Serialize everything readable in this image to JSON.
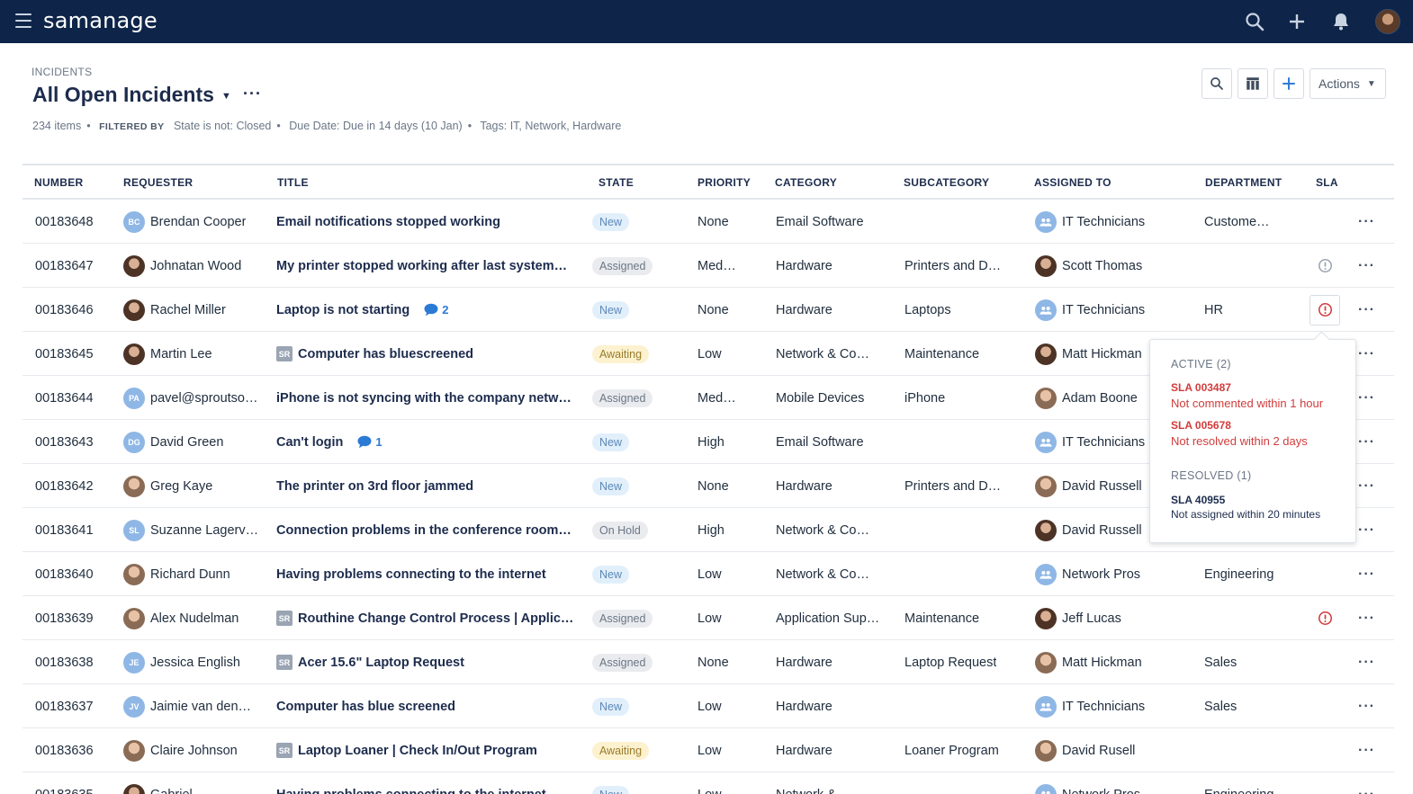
{
  "app": {
    "logo": "samanage"
  },
  "colors": {
    "topbar": "#0e2549",
    "accent": "#2b7ad6",
    "sla_alert": "#d23b3b"
  },
  "topbar": {
    "icons": [
      "search-icon",
      "plus-icon",
      "bell-icon"
    ]
  },
  "header": {
    "breadcrumb": "INCIDENTS",
    "title": "All Open Incidents",
    "actions_label": "Actions"
  },
  "filters": {
    "count": "234 items",
    "filtered_by_label": "FILTERED BY",
    "items": [
      "State is not: Closed",
      "Due Date: Due in 14 days (10 Jan)",
      "Tags: IT, Network, Hardware"
    ]
  },
  "table": {
    "columns": [
      "NUMBER",
      "REQUESTER",
      "TITLE",
      "STATE",
      "PRIORITY",
      "CATEGORY",
      "SUBCATEGORY",
      "ASSIGNED TO",
      "DEPARTMENT",
      "SLA"
    ],
    "rows": [
      {
        "number": "00183648",
        "requester": "Brendan Cooper",
        "initials": "BC",
        "title": "Email notifications stopped working",
        "state": "New",
        "priority": "None",
        "category": "Email Software",
        "subcategory": "",
        "assigned": "IT Technicians",
        "department": "Custome…"
      },
      {
        "number": "00183647",
        "requester": "Johnatan Wood",
        "initials": "",
        "title": "My printer stopped working after last system…",
        "state": "Assigned",
        "priority": "Med…",
        "category": "Hardware",
        "subcategory": "Printers and D…",
        "assigned": "Scott Thomas",
        "department": ""
      },
      {
        "number": "00183646",
        "requester": "Rachel Miller",
        "initials": "",
        "title": "Laptop is not starting",
        "comments": "2",
        "state": "New",
        "priority": "None",
        "category": "Hardware",
        "subcategory": "Laptops",
        "assigned": "IT Technicians",
        "department": "HR"
      },
      {
        "number": "00183645",
        "requester": "Martin Lee",
        "initials": "",
        "sr": "SR",
        "title": "Computer has bluescreened",
        "state": "Awaiting",
        "priority": "Low",
        "category": "Network & Co…",
        "subcategory": "Maintenance",
        "assigned": "Matt Hickman",
        "department": ""
      },
      {
        "number": "00183644",
        "requester": "pavel@sproutso…",
        "initials": "PA",
        "title": "iPhone is not syncing with the company netw…",
        "state": "Assigned",
        "priority": "Med…",
        "category": "Mobile Devices",
        "subcategory": "iPhone",
        "assigned": "Adam Boone",
        "department": ""
      },
      {
        "number": "00183643",
        "requester": "David Green",
        "initials": "DG",
        "title": "Can't login",
        "comments": "1",
        "state": "New",
        "priority": "High",
        "category": "Email Software",
        "subcategory": "",
        "assigned": "IT Technicians",
        "department": ""
      },
      {
        "number": "00183642",
        "requester": "Greg Kaye",
        "initials": "",
        "title": "The printer on 3rd floor jammed",
        "state": "New",
        "priority": "None",
        "category": "Hardware",
        "subcategory": "Printers and D…",
        "assigned": "David Russell",
        "department": ""
      },
      {
        "number": "00183641",
        "requester": "Suzanne Lagerv…",
        "initials": "SL",
        "title": "Connection problems in the conference room…",
        "state": "On Hold",
        "priority": "High",
        "category": "Network & Co…",
        "subcategory": "",
        "assigned": "David Russell",
        "department": ""
      },
      {
        "number": "00183640",
        "requester": "Richard Dunn",
        "initials": "",
        "title": "Having problems connecting to the internet",
        "state": "New",
        "priority": "Low",
        "category": "Network & Co…",
        "subcategory": "",
        "assigned": "Network Pros",
        "department": "Engineering"
      },
      {
        "number": "00183639",
        "requester": "Alex Nudelman",
        "initials": "",
        "sr": "SR",
        "title": "Routhine Change Control Process | Applic…",
        "state": "Assigned",
        "priority": "Low",
        "category": "Application Sup…",
        "subcategory": "Maintenance",
        "assigned": "Jeff Lucas",
        "department": ""
      },
      {
        "number": "00183638",
        "requester": "Jessica English",
        "initials": "JE",
        "sr": "SR",
        "title": "Acer 15.6\" Laptop Request",
        "state": "Assigned",
        "priority": "None",
        "category": "Hardware",
        "subcategory": "Laptop Request",
        "assigned": "Matt Hickman",
        "department": "Sales"
      },
      {
        "number": "00183637",
        "requester": "Jaimie van den…",
        "initials": "JV",
        "title": "Computer has blue screened",
        "state": "New",
        "priority": "Low",
        "category": "Hardware",
        "subcategory": "",
        "assigned": "IT Technicians",
        "department": "Sales"
      },
      {
        "number": "00183636",
        "requester": "Claire Johnson",
        "initials": "",
        "sr": "SR",
        "title": "Laptop Loaner | Check In/Out Program",
        "state": "Awaiting",
        "priority": "Low",
        "category": "Hardware",
        "subcategory": "Loaner Program",
        "assigned": "David Rusell",
        "department": ""
      },
      {
        "number": "00183635",
        "requester": "Gabriel…",
        "initials": "",
        "title": "Having problems connecting to the internet",
        "state": "New",
        "priority": "Low",
        "category": "Network &…",
        "subcategory": "",
        "assigned": "Network Pros",
        "department": "Engineering"
      }
    ]
  },
  "sla_popover": {
    "active_label": "ACTIVE (2)",
    "active": [
      {
        "id": "SLA 003487",
        "desc": "Not commented within 1 hour"
      },
      {
        "id": "SLA 005678",
        "desc": "Not resolved within 2 days"
      }
    ],
    "resolved_label": "RESOLVED (1)",
    "resolved": [
      {
        "id": "SLA 40955",
        "desc": "Not assigned within 20 minutes"
      }
    ]
  }
}
